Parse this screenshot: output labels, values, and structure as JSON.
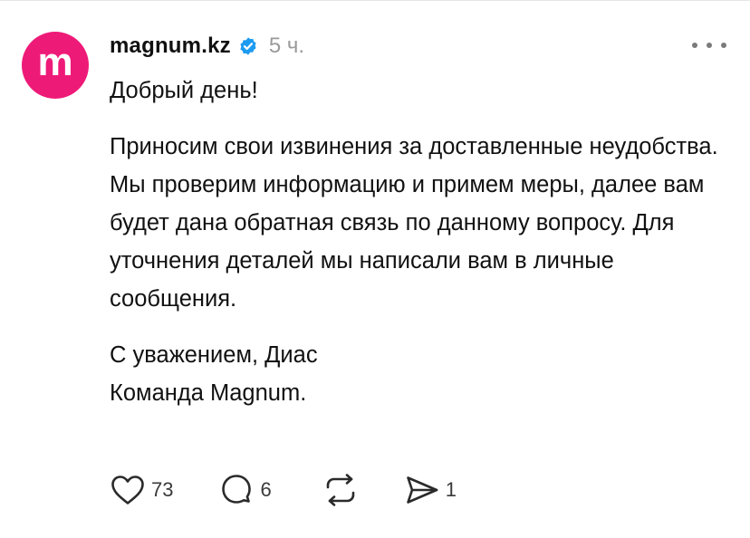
{
  "post": {
    "avatar_icon": "magnum-logo-icon",
    "avatar_letter": "m",
    "avatar_color": "#ee1a78",
    "username": "magnum.kz",
    "verified_icon": "verified-badge-icon",
    "verified_color": "#1d9bf0",
    "timestamp": "5 ч.",
    "greeting": "Добрый день!",
    "message": "Приносим свои извинения за доставленные неудобства. Мы проверим информацию и примем меры, далее вам будет дана обратная связь по данному вопросу. Для уточнения деталей мы написали вам в личные сообщения.",
    "signature_line1": "С уважением, Диас",
    "signature_line2": "Команда Magnum."
  },
  "actions": {
    "like_icon": "heart-icon",
    "like_count": "73",
    "reply_icon": "comment-bubble-icon",
    "reply_count": "6",
    "repost_icon": "repost-icon",
    "share_icon": "send-icon",
    "share_count": "1"
  }
}
